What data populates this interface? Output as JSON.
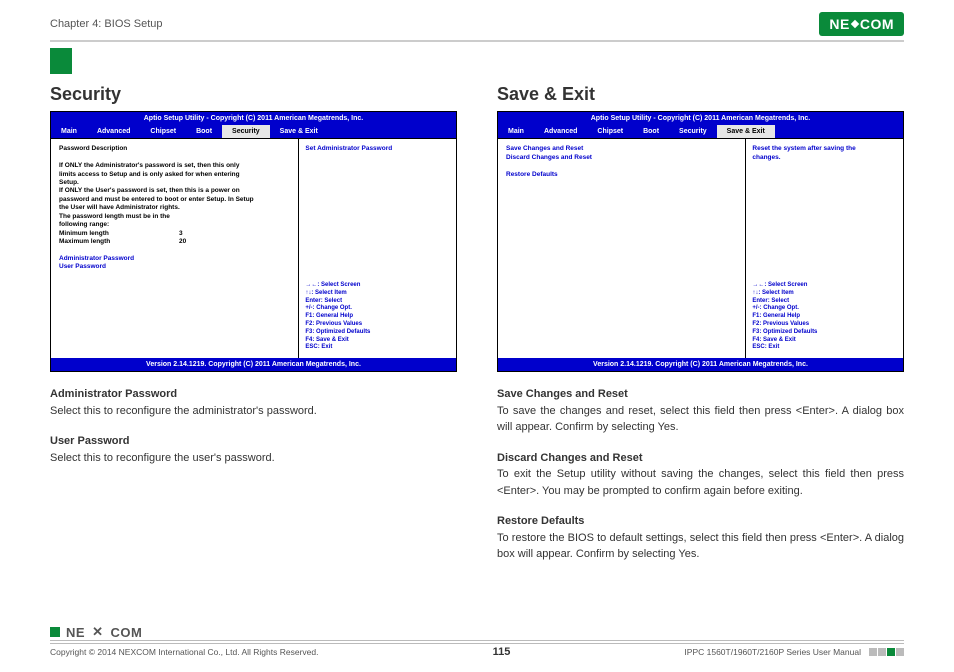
{
  "header": {
    "chapter": "Chapter 4: BIOS Setup",
    "logo_left": "NE",
    "logo_right": "COM"
  },
  "left": {
    "heading": "Security",
    "bios": {
      "title": "Aptio Setup Utility - Copyright (C) 2011 American Megatrends, Inc.",
      "tabs": [
        "Main",
        "Advanced",
        "Chipset",
        "Boot",
        "Security",
        "Save & Exit"
      ],
      "active_tab": "Security",
      "body": {
        "pwd_desc_heading": "Password Description",
        "pwd_desc_p1": "If ONLY the Administrator's password is set, then this only limits access to Setup and is only asked for when entering Setup.",
        "pwd_desc_p2": "If ONLY the User's password is set, then this is a power on password and must be entered to boot or enter Setup. In Setup the User will have Administrator rights.",
        "pwd_range_heading": "The password length must be in the following range:",
        "min_label": "Minimum length",
        "min_value": "3",
        "max_label": "Maximum length",
        "max_value": "20",
        "admin_pw": "Administrator Password",
        "user_pw": "User Password"
      },
      "right_top": "Set Administrator Password",
      "help": [
        "→←: Select Screen",
        "↑↓: Select Item",
        "Enter: Select",
        "+/-: Change Opt.",
        "F1: General Help",
        "F2: Previous Values",
        "F3: Optimized Defaults",
        "F4: Save & Exit",
        "ESC: Exit"
      ],
      "footer": "Version 2.14.1219. Copyright (C) 2011 American Megatrends, Inc."
    },
    "desc1_h": "Administrator Password",
    "desc1_t": "Select this to reconfigure the administrator's password.",
    "desc2_h": "User Password",
    "desc2_t": "Select this to reconfigure the user's password."
  },
  "right": {
    "heading": "Save & Exit",
    "bios": {
      "title": "Aptio Setup Utility - Copyright (C) 2011 American Megatrends, Inc.",
      "tabs": [
        "Main",
        "Advanced",
        "Chipset",
        "Boot",
        "Security",
        "Save & Exit"
      ],
      "active_tab": "Save & Exit",
      "body": {
        "item1": "Save Changes and Reset",
        "item2": "Discard Changes and Reset",
        "item3": "Restore Defaults"
      },
      "right_top": "Reset the system after saving the changes.",
      "help": [
        "→←: Select Screen",
        "↑↓: Select Item",
        "Enter: Select",
        "+/-: Change Opt.",
        "F1: General Help",
        "F2: Previous Values",
        "F3: Optimized Defaults",
        "F4: Save & Exit",
        "ESC: Exit"
      ],
      "footer": "Version 2.14.1219. Copyright (C) 2011 American Megatrends, Inc."
    },
    "desc1_h": "Save Changes and Reset",
    "desc1_t": "To save the changes and reset, select this field then press <Enter>. A dialog box will appear. Confirm by selecting Yes.",
    "desc2_h": "Discard Changes and Reset",
    "desc2_t": "To exit the Setup utility without saving the changes, select this field then press <Enter>. You may be prompted to confirm again before exiting.",
    "desc3_h": "Restore Defaults",
    "desc3_t": "To restore the BIOS to default settings, select this field then press <Enter>. A dialog box will appear. Confirm by selecting Yes."
  },
  "footer": {
    "brand_left": "NE",
    "brand_right": "COM",
    "copyright": "Copyright © 2014 NEXCOM International Co., Ltd. All Rights Reserved.",
    "page": "115",
    "manual": "IPPC 1560T/1960T/2160P Series User Manual"
  }
}
